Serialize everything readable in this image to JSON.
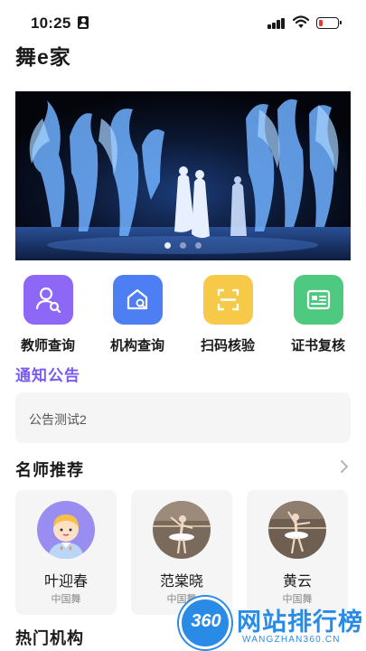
{
  "status_bar": {
    "time": "10:25",
    "battery_color": "#e53935",
    "battery_level": 0.25
  },
  "app": {
    "title": "舞e家"
  },
  "banner": {
    "dots": 3,
    "active_dot": 0,
    "icon": "dance-performance-photo"
  },
  "quick_menu": [
    {
      "label": "教师查询",
      "icon": "teacher-search-icon",
      "color": "#8d67f5"
    },
    {
      "label": "机构查询",
      "icon": "institution-search-icon",
      "color": "#4e7ef4"
    },
    {
      "label": "扫码核验",
      "icon": "scan-icon",
      "color": "#f6c948"
    },
    {
      "label": "证书复核",
      "icon": "certificate-icon",
      "color": "#4dca7f"
    }
  ],
  "notice": {
    "title": "通知公告",
    "title_color": "#7a5af5",
    "items": [
      "公告测试2"
    ]
  },
  "teachers": {
    "title": "名师推荐",
    "more_icon": "chevron-right-icon",
    "items": [
      {
        "name": "叶迎春",
        "tag": "中国舞"
      },
      {
        "name": "范棠晓",
        "tag": "中国舞"
      },
      {
        "name": "黄云",
        "tag": "中国舞"
      }
    ]
  },
  "institutions": {
    "title": "热门机构"
  },
  "watermark": {
    "badge": "360",
    "text": "网站排行榜",
    "subtext": "WANGZHAN360.CN",
    "color": "#2a8be6"
  }
}
